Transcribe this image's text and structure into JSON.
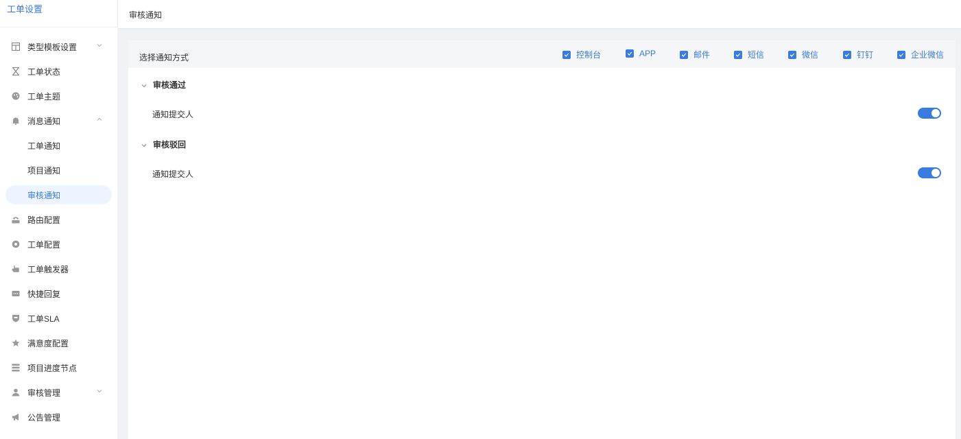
{
  "sidebar": {
    "title": "工单设置",
    "items": [
      {
        "label": "类型模板设置",
        "icon": "template-icon",
        "chevron": "down"
      },
      {
        "label": "工单状态",
        "icon": "hourglass-icon"
      },
      {
        "label": "工单主题",
        "icon": "palette-icon"
      },
      {
        "label": "消息通知",
        "icon": "bell-icon",
        "chevron": "up"
      },
      {
        "label": "路由配置",
        "icon": "router-icon"
      },
      {
        "label": "工单配置",
        "icon": "gear-icon"
      },
      {
        "label": "工单触发器",
        "icon": "hand-icon"
      },
      {
        "label": "快捷回复",
        "icon": "chat-icon"
      },
      {
        "label": "工单SLA",
        "icon": "shield-icon"
      },
      {
        "label": "满意度配置",
        "icon": "star-icon"
      },
      {
        "label": "项目进度节点",
        "icon": "list-icon"
      },
      {
        "label": "审核管理",
        "icon": "user-icon",
        "chevron": "down"
      },
      {
        "label": "公告管理",
        "icon": "megaphone-icon"
      }
    ],
    "sub_items": [
      {
        "label": "工单通知"
      },
      {
        "label": "项目通知"
      },
      {
        "label": "审核通知",
        "active": true
      }
    ]
  },
  "topbar": {
    "tab": "审核通知"
  },
  "panel": {
    "head_label": "选择通知方式",
    "channels": [
      {
        "label": "控制台",
        "checked": true
      },
      {
        "label": "APP",
        "checked": true
      },
      {
        "label": "邮件",
        "checked": true
      },
      {
        "label": "短信",
        "checked": true
      },
      {
        "label": "微信",
        "checked": true
      },
      {
        "label": "钉钉",
        "checked": true
      },
      {
        "label": "企业微信",
        "checked": true
      }
    ],
    "sections": [
      {
        "title": "审核通过",
        "row_label": "通知提交人",
        "enabled": true
      },
      {
        "title": "审核驳回",
        "row_label": "通知提交人",
        "enabled": true
      }
    ]
  },
  "colors": {
    "accent": "#3a7be0",
    "active_bg": "#eef4ff",
    "page_bg": "#f0f2f5"
  }
}
